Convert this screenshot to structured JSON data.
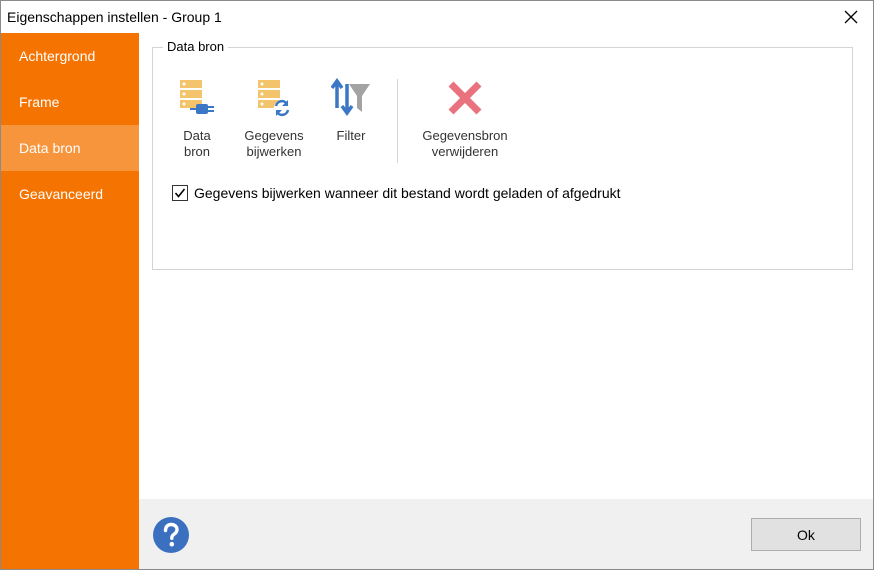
{
  "window": {
    "title": "Eigenschappen instellen - Group 1"
  },
  "sidebar": {
    "items": [
      {
        "label": "Achtergrond"
      },
      {
        "label": "Frame"
      },
      {
        "label": "Data bron",
        "active": true
      },
      {
        "label": "Geavanceerd"
      }
    ]
  },
  "group": {
    "legend": "Data bron"
  },
  "toolbar": {
    "data_source": {
      "line1": "Data",
      "line2": "bron",
      "icon": "data-source-plug-icon"
    },
    "refresh": {
      "line1": "Gegevens",
      "line2": "bijwerken",
      "icon": "data-refresh-icon"
    },
    "filter": {
      "line1": "Filter",
      "icon": "filter-funnel-icon"
    },
    "remove": {
      "line1": "Gegevensbron",
      "line2": "verwijderen",
      "icon": "remove-x-icon"
    }
  },
  "option": {
    "label": "Gegevens bijwerken wanneer dit bestand wordt geladen of afgedrukt",
    "checked": true
  },
  "footer": {
    "ok_label": "Ok",
    "help_icon": "help-question-icon"
  },
  "colors": {
    "sidebar": "#f57300",
    "sidebar_active": "#f7953d",
    "db_yellow": "#f3c46b",
    "blue": "#3b77c4",
    "remove_red": "#e8737e",
    "help_blue": "#3b6fbf"
  }
}
